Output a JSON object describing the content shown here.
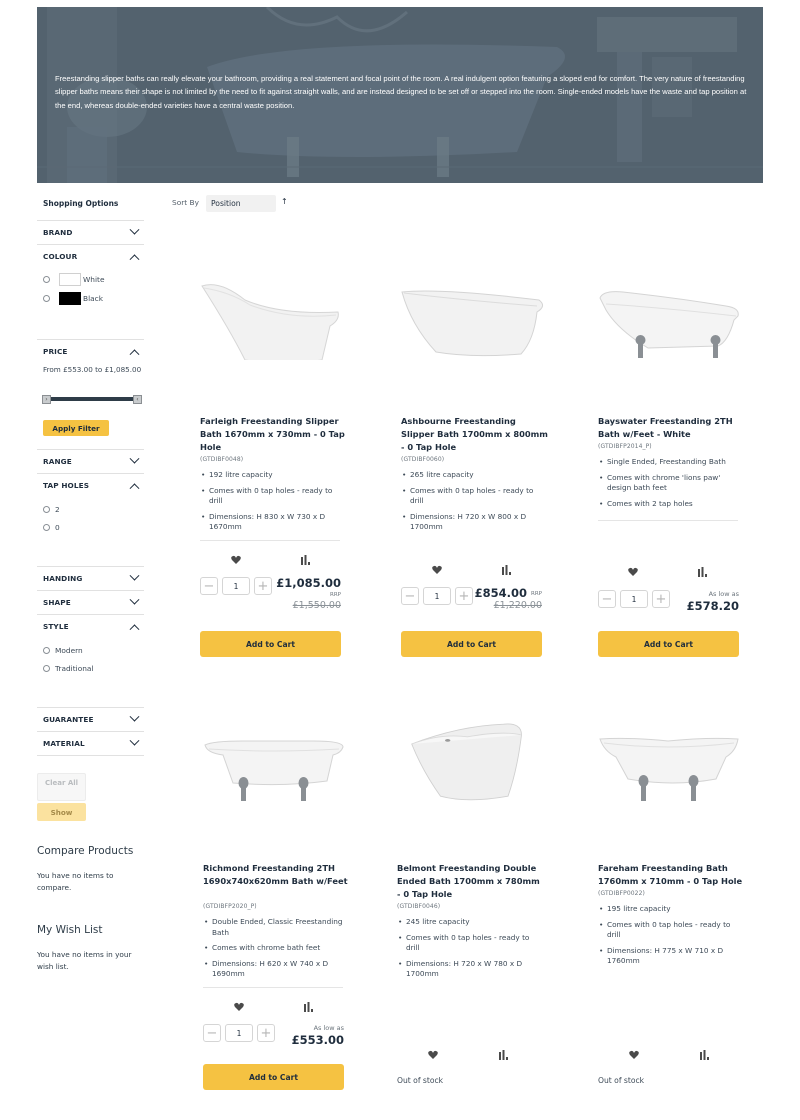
{
  "banner": {
    "text": "Freestanding slipper baths can really elevate your bathroom, providing a real statement and focal point of the room. A real indulgent option featuring a sloped end for comfort. The very nature of freestanding slipper baths means their shape is not limited by the need to fit against straight walls, and are instead designed to be set off or stepped into the room. Single-ended models have the waste and tap position at the end, whereas double-ended varieties have a central waste position."
  },
  "sidebar": {
    "title": "Shopping Options",
    "filters": {
      "brand": "BRAND",
      "colour": "COLOUR",
      "price": "PRICE",
      "range": "RANGE",
      "tap_holes": "TAP HOLES",
      "handing": "HANDING",
      "shape": "SHAPE",
      "style": "STYLE",
      "guarantee": "GUARANTEE",
      "material": "MATERIAL"
    },
    "colour_options": [
      {
        "label": "White",
        "swatch": "#ffffff"
      },
      {
        "label": "Black",
        "swatch": "#000000"
      }
    ],
    "price_range_text": "From £553.00 to £1,085.00",
    "price_min": 553.0,
    "price_max": 1085.0,
    "apply_filter_label": "Apply Filter",
    "tap_hole_options": [
      "2",
      "0"
    ],
    "style_options": [
      "Modern",
      "Traditional"
    ],
    "clear_all_label": "Clear All",
    "show_label": "Show",
    "compare": {
      "title": "Compare Products",
      "text": "You have no items to compare."
    },
    "wishlist": {
      "title": "My Wish List",
      "text": "You have no items in your wish list."
    }
  },
  "toolbar": {
    "sort_label": "Sort By",
    "sort_value": "Position",
    "sort_direction_icon": "arrow-up-icon"
  },
  "colors": {
    "accent": "#f5c242",
    "text_dark": "#1f2d3d",
    "banner_overlay": "#4f5e6a"
  },
  "products": [
    {
      "name": "Farleigh Freestanding Slipper Bath 1670mm x 730mm - 0 Tap Hole",
      "sku": "(GTDIBF0048)",
      "features": [
        "192 litre capacity",
        "Comes with 0 tap holes - ready to drill",
        "Dimensions: H 830 x W 730 x D 1670mm"
      ],
      "qty": "1",
      "price": "£1,085.00",
      "rrp_label": "RRP",
      "old_price": "£1,550.00",
      "cart_label": "Add to Cart"
    },
    {
      "name": "Ashbourne Freestanding Slipper Bath 1700mm x 800mm - 0 Tap Hole",
      "sku": "(GTDIBF0060)",
      "features": [
        "265 litre capacity",
        "Comes with 0 tap holes - ready to drill",
        "Dimensions: H 720 x W 800 x D 1700mm"
      ],
      "qty": "1",
      "price": "£854.00",
      "rrp_label": "RRP",
      "old_price": "£1,220.00",
      "cart_label": "Add to Cart"
    },
    {
      "name": "Bayswater Freestanding 2TH Bath w/Feet - White",
      "sku": "(GTDIBFP2014_P)",
      "features": [
        "Single Ended, Freestanding Bath",
        "Comes with chrome 'lions paw' design bath feet",
        "Comes with 2 tap holes"
      ],
      "qty": "1",
      "as_low_label": "As low as",
      "price": "£578.20",
      "cart_label": "Add to Cart"
    },
    {
      "name": "Richmond Freestanding 2TH 1690x740x620mm Bath w/Feet",
      "sku": "(GTDIBFP2020_P)",
      "features": [
        "Double Ended, Classic Freestanding Bath",
        "Comes with chrome bath feet",
        "Dimensions: H 620 x W 740 x D 1690mm"
      ],
      "qty": "1",
      "as_low_label": "As low as",
      "price": "£553.00",
      "cart_label": "Add to Cart"
    },
    {
      "name": "Belmont Freestanding Double Ended Bath 1700mm x 780mm - 0 Tap Hole",
      "sku": "(GTDIBF0046)",
      "features": [
        "245 litre capacity",
        "Comes with 0 tap holes - ready to drill",
        "Dimensions: H 720 x W 780 x D 1700mm"
      ],
      "stock_status": "Out of stock"
    },
    {
      "name": "Fareham Freestanding Bath 1760mm x 710mm - 0 Tap Hole",
      "sku": "(GTDIBFP0022)",
      "features": [
        "195 litre capacity",
        "Comes with 0 tap holes - ready to drill",
        "Dimensions: H 775 x W 710 x D 1760mm"
      ],
      "stock_status": "Out of stock"
    }
  ]
}
